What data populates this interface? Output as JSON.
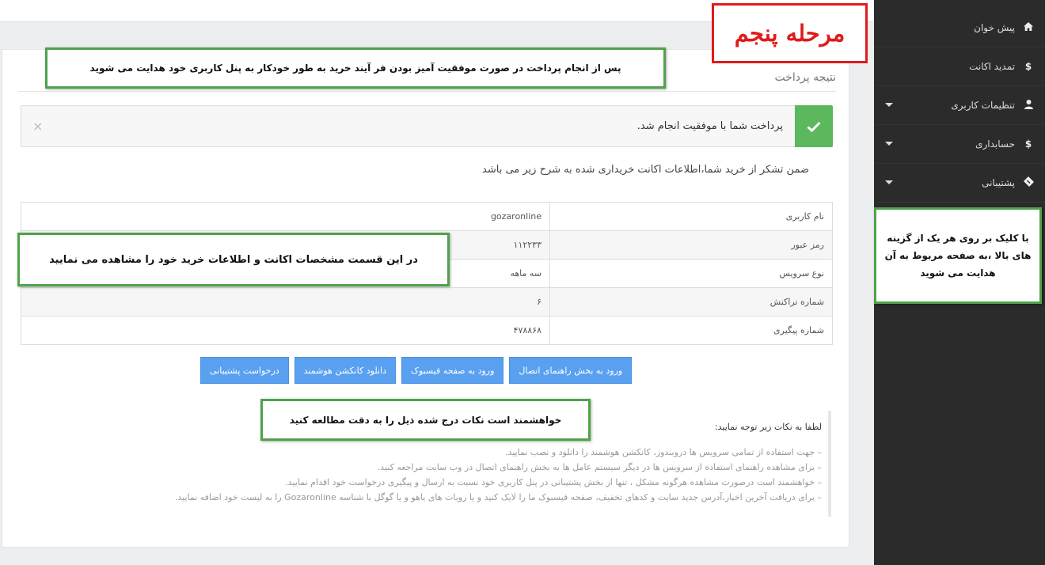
{
  "panel": {
    "result_title": "نتیجه پرداخت",
    "alert_text": "پرداخت شما با موفقیت انجام شد.",
    "alert_close": "×",
    "intro": "ضمن تشکر از خرید شما،اطلاعات اکانت خریداری شده به شرح زیر می باشد",
    "rows": [
      {
        "key": "نام کاربری",
        "value": "gozaronline"
      },
      {
        "key": "رمز عبور",
        "value": "۱۱۲۲۳۳"
      },
      {
        "key": "نوع سرویس",
        "value": "سه ماهه"
      },
      {
        "key": "شماره تراکنش",
        "value": "۶"
      },
      {
        "key": "شماره پیگیری",
        "value": "۴۷۸۸۶۸"
      }
    ],
    "buttons": [
      "ورود به بخش راهنمای اتصال",
      "ورود به صفحه فیسبوک",
      "دانلود کانکشن هوشمند",
      "درخواست پشتیبانی"
    ],
    "notes_title": "لطفا به نکات زیر توجه نمایید:",
    "notes": [
      "– جهت استفاده از تمامی سرویس ها دروبندوز، کانکشن هوشمند را دانلود و نصب نمایید.",
      "– برای مشاهده راهنمای استفاده از سرویس ها در دیگر سیستم عامل ها به بخش راهنمای اتصال در وب سایت مراجعه کنید.",
      "– خواهشمند است درصورت مشاهده هرگونه مشکل ، تنها از بخش پشتیبانی در پنل کاربری خود نسبت به ارسال و پیگیری درخواست خود اقدام نمایید.",
      "– برای دریافت آخرین اخبار،آدرس جدید سایت و کدهای تخفیف، صفحه فیسبوک ما را لایک کنید و یا روبات های یاهو و یا گوگل با شناسه Gozaronline را به لیست خود اضافه نمایید."
    ]
  },
  "annotations": {
    "step": "مرحله پنجم",
    "top": "پس از انجام پرداخت  در صورت موفقیت آمیز بودن فر آیند خرید به طور خودکار به پنل کاربری خود هدایت می شوید",
    "table": "در این قسمت مشخصات اکانت و اطلاعات خرید خود را مشاهده می نمایید",
    "notes": "خواهشمند است  نکات درج شده ذیل را به دقت مطالعه کنید",
    "sidebar": "با کلیک بر روی هر یک از گزینه های بالا ،به صفحه مربوط به آن هدایت می شوید"
  },
  "sidebar": {
    "items": [
      {
        "label": "پیش خوان",
        "icon": "home-icon",
        "caret": false
      },
      {
        "label": "تمدید اکانت",
        "icon": "dollar-icon",
        "caret": false
      },
      {
        "label": "تنظیمات کاربری",
        "icon": "user-icon",
        "caret": true
      },
      {
        "label": "حسابداری",
        "icon": "dollar-icon",
        "caret": true
      },
      {
        "label": "پشتیبانی",
        "icon": "ticket-icon",
        "caret": true
      }
    ]
  },
  "colors": {
    "sidebar_bg": "#2b2b2b",
    "success": "#5cb85c",
    "button": "#5aa0f0",
    "annotation_green": "#4fa34a",
    "annotation_red": "#e01b1b"
  }
}
